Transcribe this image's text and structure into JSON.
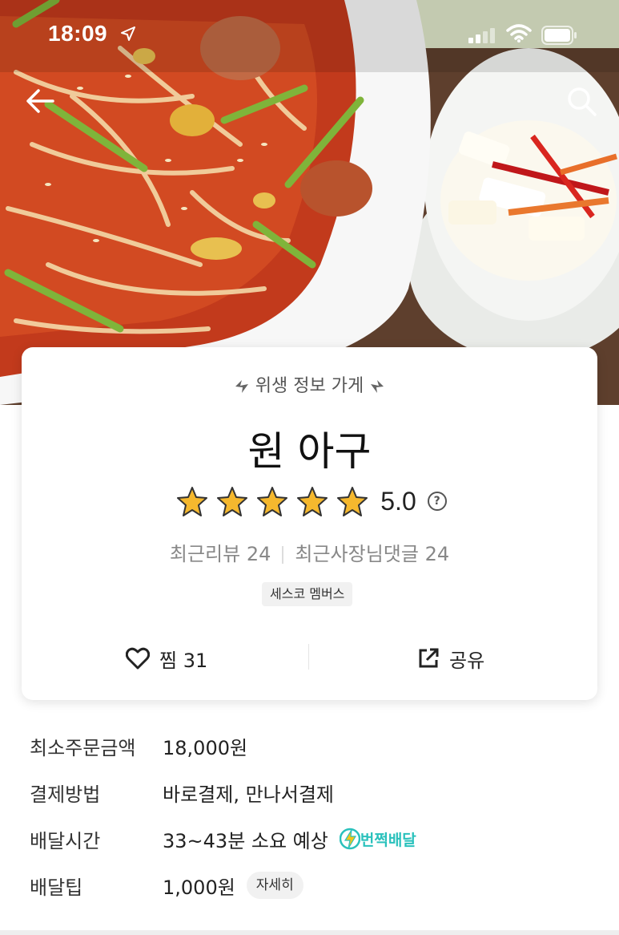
{
  "status_bar": {
    "time": "18:09"
  },
  "header": {
    "back_icon": "arrow-left-icon",
    "search_icon": "search-icon"
  },
  "store": {
    "hygiene_label": "위생 정보 가게",
    "name": "원 아구",
    "rating": {
      "stars": 5,
      "max": 5,
      "score": "5.0"
    },
    "recent_reviews": "최근리뷰 24",
    "owner_replies": "최근사장님댓글 24",
    "badge": "세스코 멤버스",
    "like_label": "찜 31",
    "share_label": "공유"
  },
  "details": [
    {
      "label": "최소주문금액",
      "value": "18,000원"
    },
    {
      "label": "결제방법",
      "value": "바로결제, 만나서결제"
    },
    {
      "label": "배달시간",
      "value": "33~43분 소요 예상",
      "tag": "번쩍배달"
    },
    {
      "label": "배달팁",
      "value": "1,000원",
      "button": "자세히"
    }
  ],
  "colors": {
    "accent": "#2ac1bc",
    "star": "#f5b82e"
  }
}
